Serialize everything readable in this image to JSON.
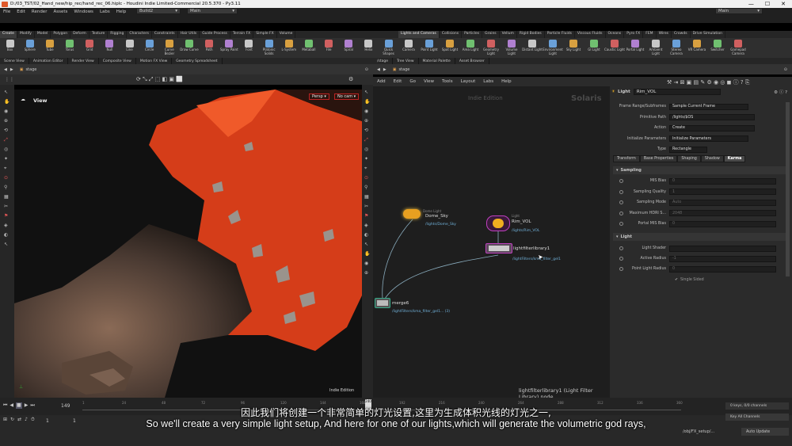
{
  "window": {
    "title": "D:/03_TST/02_Hand_new/hip_rec/hand_rec_06.hiplc - Houdini Indie Limited-Commercial 20.5.370 - Py3.11",
    "minimize": "—",
    "maximize": "☐",
    "close": "✕"
  },
  "menu": [
    "File",
    "Edit",
    "Render",
    "Assets",
    "Windows",
    "Labs",
    "Help"
  ],
  "desktops": {
    "left": "Build2",
    "center": "Main",
    "right": "Main"
  },
  "shelf_left": {
    "tabs": [
      "Create",
      "Modify",
      "Model",
      "Polygon",
      "Deform",
      "Texture",
      "Rigging",
      "Characters",
      "Constraints",
      "Hair Utils",
      "Guide Process",
      "Terrain FX",
      "Simple FX",
      "Volume"
    ],
    "tools": [
      "Box",
      "Sphere",
      "Tube",
      "Torus",
      "Grid",
      "Null",
      "Line",
      "Circle",
      "Curve Bezier",
      "Draw Curve",
      "Path",
      "Spray Paint",
      "Font",
      "Platonic Solids",
      "L-System",
      "Metaball",
      "File",
      "Spiral",
      "Helix",
      "Quick Shapes"
    ]
  },
  "shelf_right": {
    "tabs": [
      "Lights and Cameras",
      "Collisions",
      "Particles",
      "Grains",
      "Vellum",
      "Rigid Bodies",
      "Particle Fluids",
      "Viscous Fluids",
      "Oceans",
      "Pyro FX",
      "FEM",
      "Wires",
      "Crowds",
      "Drive Simulation"
    ],
    "tools": [
      "Camera",
      "Point Light",
      "Spot Light",
      "Area Light",
      "Geometry Light",
      "Volume Light",
      "Distant Light",
      "Environment Light",
      "Sky Light",
      "GI Light",
      "Caustic Light",
      "Portal Light",
      "Ambient Light",
      "Stereo Camera",
      "VR Camera",
      "Switcher",
      "Gamepad Camera"
    ]
  },
  "viewport_tabs": [
    "Scene View",
    "Animation Editor",
    "Render View",
    "Composite View",
    "Motion FX View",
    "Geometry Spreadsheet"
  ],
  "viewport": {
    "path": "stage",
    "label": "View",
    "persp": "Persp ▾",
    "cam": "No cam ▾",
    "watermark": "Indie Edition"
  },
  "network_tabs": [
    "/stage",
    "Tree View",
    "Material Palette",
    "Asset Browser"
  ],
  "network": {
    "path": "stage",
    "menu": [
      "Add",
      "Edit",
      "Go",
      "View",
      "Tools",
      "Layout",
      "Labs",
      "Help"
    ],
    "watermark": "Indie Edition",
    "context": "Solaris",
    "nodes": [
      {
        "name": "Dome_Sky",
        "type": "Dome Light",
        "path": "/lights/Dome_Sky"
      },
      {
        "name": "Rim_VOL",
        "type": "Light",
        "path": "/lights/Rim_VOL"
      },
      {
        "name": "lightfilterlibrary1",
        "type": "",
        "path": "/lightFilters/kma_filter_gel1"
      },
      {
        "name": "merge6",
        "type": "",
        "path": "/lightFilters/kma_filter_gel1... (3)"
      }
    ],
    "status": "lightfilterlibrary1 (Light Filter Library) node"
  },
  "params": {
    "node_type": "Light",
    "node_name": "Rim_VOL",
    "rows": [
      {
        "label": "Frame Range/Subframes",
        "value": "Sample Current Frame"
      },
      {
        "label": "Primitive Path",
        "value": "/lights/$OS"
      },
      {
        "label": "Action",
        "value": "Create"
      },
      {
        "label": "Initialize Parameters",
        "value": "Initialize Parameters"
      },
      {
        "label": "Type",
        "value": "Rectangle"
      }
    ],
    "tabs": [
      "Transform",
      "Base Properties",
      "Shaping",
      "Shadow",
      "Karma"
    ],
    "sampling_title": "Sampling",
    "sampling_rows": [
      {
        "label": "MIS Bias",
        "value": "0"
      },
      {
        "label": "Sampling Quality",
        "value": "1"
      },
      {
        "label": "Sampling Mode",
        "value": "Auto"
      },
      {
        "label": "Maximum HDRI S...",
        "value": "2048"
      },
      {
        "label": "Portal MIS Bias",
        "value": "0"
      }
    ],
    "light_title": "Light",
    "light_rows": [
      {
        "label": "Light Shader",
        "value": ""
      },
      {
        "label": "Active Radius",
        "value": "-1"
      },
      {
        "label": "Point Light Radius",
        "value": "0"
      }
    ],
    "single_sided": "Single Sided"
  },
  "timeline": {
    "frame": "149",
    "ticks": [
      "1",
      "24",
      "48",
      "72",
      "96",
      "120",
      "144",
      "168",
      "192",
      "216",
      "240",
      "264",
      "288",
      "312",
      "336",
      "360"
    ],
    "start": "1",
    "end": "1",
    "end2": "240",
    "keys": "0 keys, 0/0 channels",
    "key_all": "Key All Channels",
    "path": "/obj/FX_setup/...",
    "auto_update": "Auto Update"
  },
  "subtitles": {
    "zh": "因此我们将创建一个非常简单的灯光设置,这里为生成体积光线的灯光之一,",
    "en": "So we'll create a very simple light setup, And here for one of our lights,which will generate the volumetric god rays,"
  }
}
